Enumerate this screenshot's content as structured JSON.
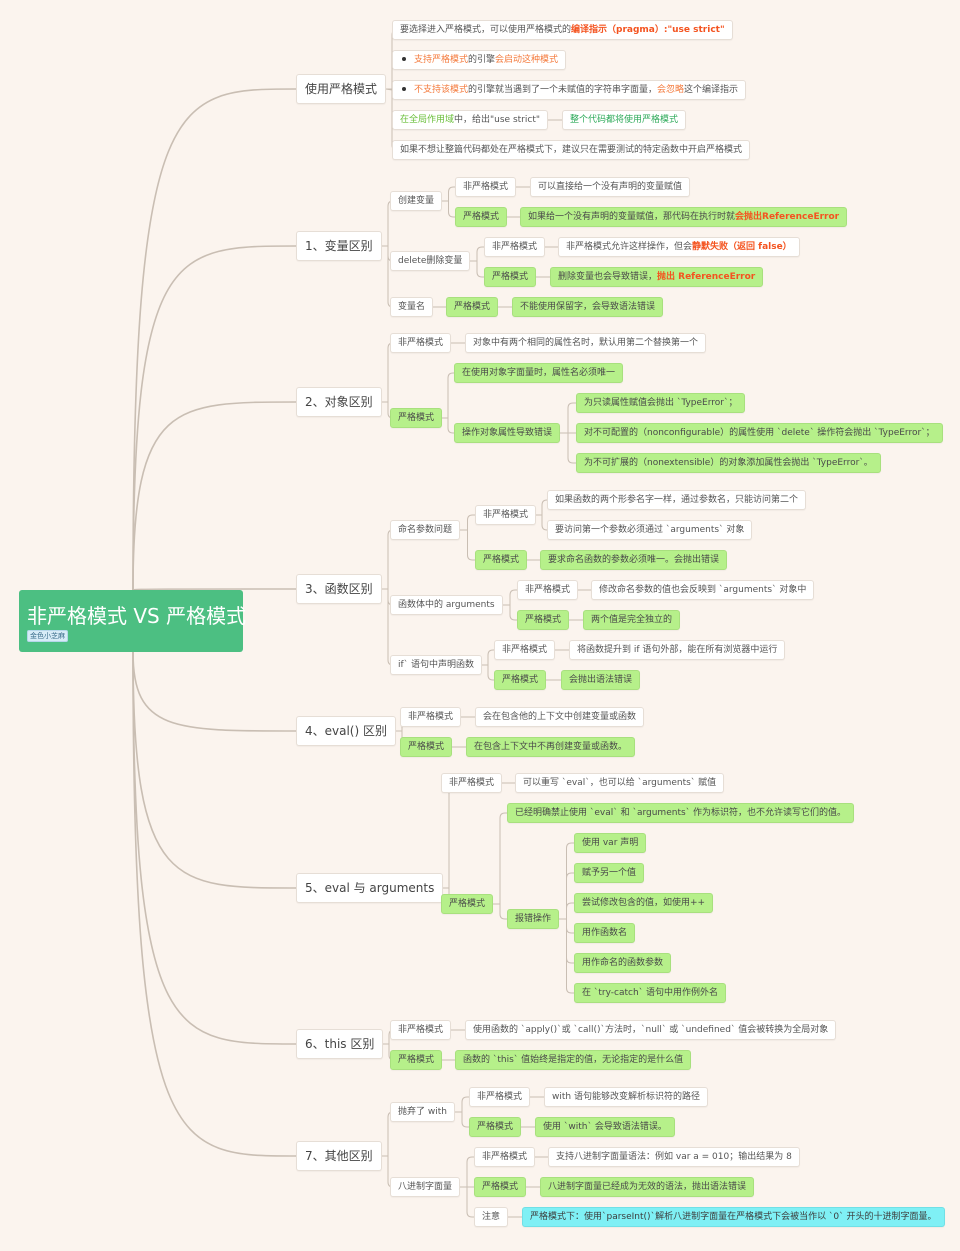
{
  "mindmap": {
    "root": {
      "title": "非严格模式 VS 严格模式",
      "tag": "金色小芝麻",
      "color": "#4cbf82"
    },
    "colors": {
      "background": "#fbf4ee",
      "line": "#c9beb3",
      "green_node": "#b6f08a",
      "cyan_node": "#7ff0f5",
      "highlight_red": "#f4531f",
      "highlight_orange": "#f47a3c"
    },
    "nodes": [
      {
        "id": "b0",
        "parent": "root",
        "level": 1,
        "text": "使用严格模式"
      },
      {
        "id": "b0a",
        "parent": "b0",
        "segments": [
          {
            "t": "要选择进入严格模式，可以使用严格模式的"
          },
          {
            "t": "编译指示（pragma）:\"use strict\"",
            "c": "hl-red"
          }
        ]
      },
      {
        "id": "b0b",
        "parent": "b0",
        "bullet": true,
        "segments": [
          {
            "t": "支持严格模式",
            "c": "hl-orange"
          },
          {
            "t": "的引擎"
          },
          {
            "t": "会启动这种模式",
            "c": "hl-orange"
          }
        ]
      },
      {
        "id": "b0c",
        "parent": "b0",
        "bullet": true,
        "segments": [
          {
            "t": "不支持该模式",
            "c": "hl-orange"
          },
          {
            "t": "的引擎就当遇到了一个未赋值的字符串字面量，"
          },
          {
            "t": "会忽略",
            "c": "hl-orange"
          },
          {
            "t": "这个编译指示"
          }
        ]
      },
      {
        "id": "b0d",
        "parent": "b0",
        "segments": [
          {
            "t": "在全局作用域",
            "c": "hl-lgreen"
          },
          {
            "t": "中，给出\"use strict\""
          }
        ]
      },
      {
        "id": "b0d1",
        "parent": "b0d",
        "segments": [
          {
            "t": "整个代码都将使用严格模式",
            "c": "hl-green"
          }
        ]
      },
      {
        "id": "b0e",
        "parent": "b0",
        "text": "如果不想让整篇代码都处在严格模式下，建议只在需要测试的特定函数中开启严格模式"
      },
      {
        "id": "b1",
        "parent": "root",
        "level": 1,
        "text": "1、变量区别"
      },
      {
        "id": "b1a",
        "parent": "b1",
        "text": "创建变量"
      },
      {
        "id": "b1a1",
        "parent": "b1a",
        "text": "非严格模式"
      },
      {
        "id": "b1a1x",
        "parent": "b1a1",
        "text": "可以直接给一个没有声明的变量赋值"
      },
      {
        "id": "b1a2",
        "parent": "b1a",
        "style": "green",
        "text": "严格模式"
      },
      {
        "id": "b1a2x",
        "parent": "b1a2",
        "style": "green",
        "segments": [
          {
            "t": "如果给一个没有声明的变量赋值，那代码在执行时就"
          },
          {
            "t": "会抛出ReferenceError",
            "c": "hl-red"
          }
        ]
      },
      {
        "id": "b1b",
        "parent": "b1",
        "text": "delete删除变量"
      },
      {
        "id": "b1b1",
        "parent": "b1b",
        "text": "非严格模式"
      },
      {
        "id": "b1b1x",
        "parent": "b1b1",
        "segments": [
          {
            "t": "非严格模式允许这样操作，但会"
          },
          {
            "t": "静默失败（返回 false）",
            "c": "hl-red"
          }
        ]
      },
      {
        "id": "b1b2",
        "parent": "b1b",
        "style": "green",
        "text": "严格模式"
      },
      {
        "id": "b1b2x",
        "parent": "b1b2",
        "style": "green",
        "segments": [
          {
            "t": "删除变量也会导致错误，"
          },
          {
            "t": "抛出 ReferenceError",
            "c": "hl-red"
          }
        ]
      },
      {
        "id": "b1c",
        "parent": "b1",
        "text": "变量名"
      },
      {
        "id": "b1c1",
        "parent": "b1c",
        "style": "green",
        "text": "严格模式"
      },
      {
        "id": "b1c1x",
        "parent": "b1c1",
        "style": "green",
        "text": "不能使用保留字，会导致语法错误"
      },
      {
        "id": "b2",
        "parent": "root",
        "level": 1,
        "text": "2、对象区别"
      },
      {
        "id": "b2a",
        "parent": "b2",
        "text": "非严格模式"
      },
      {
        "id": "b2ax",
        "parent": "b2a",
        "text": "对象中有两个相同的属性名时，默认用第二个替换第一个"
      },
      {
        "id": "b2b",
        "parent": "b2",
        "style": "green",
        "text": "严格模式"
      },
      {
        "id": "b2b1",
        "parent": "b2b",
        "style": "green",
        "text": "在使用对象字面量时，属性名必须唯一"
      },
      {
        "id": "b2b2",
        "parent": "b2b",
        "style": "green",
        "text": "操作对象属性导致错误"
      },
      {
        "id": "b2b2a",
        "parent": "b2b2",
        "style": "green",
        "text": "为只读属性赋值会抛出 `TypeError`；"
      },
      {
        "id": "b2b2b",
        "parent": "b2b2",
        "style": "green",
        "text": "对不可配置的（nonconfigurable）的属性使用 `delete` 操作符会抛出 `TypeError`；"
      },
      {
        "id": "b2b2c",
        "parent": "b2b2",
        "style": "green",
        "text": "为不可扩展的（nonextensible）的对象添加属性会抛出 `TypeError`。"
      },
      {
        "id": "b3",
        "parent": "root",
        "level": 1,
        "text": "3、函数区别"
      },
      {
        "id": "b3a",
        "parent": "b3",
        "text": "命名参数问题"
      },
      {
        "id": "b3a1",
        "parent": "b3a",
        "text": "非严格模式"
      },
      {
        "id": "b3a1a",
        "parent": "b3a1",
        "text": "如果函数的两个形参名字一样，通过参数名，只能访问第二个"
      },
      {
        "id": "b3a1b",
        "parent": "b3a1",
        "text": "要访问第一个参数必须通过 `arguments` 对象"
      },
      {
        "id": "b3a2",
        "parent": "b3a",
        "style": "green",
        "text": "严格模式"
      },
      {
        "id": "b3a2x",
        "parent": "b3a2",
        "style": "green",
        "text": "要求命名函数的参数必须唯一。会抛出错误"
      },
      {
        "id": "b3b",
        "parent": "b3",
        "text": "函数体中的 arguments"
      },
      {
        "id": "b3b1",
        "parent": "b3b",
        "text": "非严格模式"
      },
      {
        "id": "b3b1x",
        "parent": "b3b1",
        "text": "修改命名参数的值也会反映到 `arguments` 对象中"
      },
      {
        "id": "b3b2",
        "parent": "b3b",
        "style": "green",
        "text": "严格模式"
      },
      {
        "id": "b3b2x",
        "parent": "b3b2",
        "style": "green",
        "text": "两个值是完全独立的"
      },
      {
        "id": "b3c",
        "parent": "b3",
        "text": "if` 语句中声明函数"
      },
      {
        "id": "b3c1",
        "parent": "b3c",
        "text": "非严格模式"
      },
      {
        "id": "b3c1x",
        "parent": "b3c1",
        "text": "将函数提升到 if 语句外部，能在所有浏览器中运行"
      },
      {
        "id": "b3c2",
        "parent": "b3c",
        "style": "green",
        "text": "严格模式"
      },
      {
        "id": "b3c2x",
        "parent": "b3c2",
        "style": "green",
        "text": "会抛出语法错误"
      },
      {
        "id": "b4",
        "parent": "root",
        "level": 1,
        "text": "4、eval() 区别"
      },
      {
        "id": "b4a",
        "parent": "b4",
        "text": "非严格模式"
      },
      {
        "id": "b4ax",
        "parent": "b4a",
        "text": "会在包含他的上下文中创建变量或函数"
      },
      {
        "id": "b4b",
        "parent": "b4",
        "style": "green",
        "text": "严格模式"
      },
      {
        "id": "b4bx",
        "parent": "b4b",
        "style": "green",
        "text": "在包含上下文中不再创建变量或函数。"
      },
      {
        "id": "b5",
        "parent": "root",
        "level": 1,
        "text": "5、eval 与 arguments"
      },
      {
        "id": "b5a",
        "parent": "b5",
        "text": "非严格模式"
      },
      {
        "id": "b5ax",
        "parent": "b5a",
        "text": "可以重写 `eval`，也可以给 `arguments` 赋值"
      },
      {
        "id": "b5b",
        "parent": "b5",
        "style": "green",
        "text": "严格模式"
      },
      {
        "id": "b5b1",
        "parent": "b5b",
        "style": "green",
        "text": "已经明确禁止使用 `eval` 和 `arguments` 作为标识符，也不允许读写它们的值。"
      },
      {
        "id": "b5b2",
        "parent": "b5b",
        "style": "green",
        "text": "报错操作"
      },
      {
        "id": "b5b2a",
        "parent": "b5b2",
        "style": "green",
        "text": "使用 var 声明"
      },
      {
        "id": "b5b2b",
        "parent": "b5b2",
        "style": "green",
        "text": "赋予另一个值"
      },
      {
        "id": "b5b2c",
        "parent": "b5b2",
        "style": "green",
        "text": "尝试修改包含的值，如使用++"
      },
      {
        "id": "b5b2d",
        "parent": "b5b2",
        "style": "green",
        "text": "用作函数名"
      },
      {
        "id": "b5b2e",
        "parent": "b5b2",
        "style": "green",
        "text": "用作命名的函数参数"
      },
      {
        "id": "b5b2f",
        "parent": "b5b2",
        "style": "green",
        "text": "在 `try-catch` 语句中用作例外名"
      },
      {
        "id": "b6",
        "parent": "root",
        "level": 1,
        "text": "6、this 区别"
      },
      {
        "id": "b6a",
        "parent": "b6",
        "text": "非严格模式"
      },
      {
        "id": "b6ax",
        "parent": "b6a",
        "text": "使用函数的 `apply()`或 `call()`方法时，`null` 或 `undefined` 值会被转换为全局对象"
      },
      {
        "id": "b6b",
        "parent": "b6",
        "style": "green",
        "text": "严格模式"
      },
      {
        "id": "b6bx",
        "parent": "b6b",
        "style": "green",
        "text": "函数的 `this` 值始终是指定的值，无论指定的是什么值"
      },
      {
        "id": "b7",
        "parent": "root",
        "level": 1,
        "text": "7、其他区别"
      },
      {
        "id": "b7a",
        "parent": "b7",
        "text": "抛弃了 with"
      },
      {
        "id": "b7a1",
        "parent": "b7a",
        "text": "非严格模式"
      },
      {
        "id": "b7a1x",
        "parent": "b7a1",
        "text": "with  语句能够改变解析标识符的路径"
      },
      {
        "id": "b7a2",
        "parent": "b7a",
        "style": "green",
        "text": "严格模式"
      },
      {
        "id": "b7a2x",
        "parent": "b7a2",
        "style": "green",
        "text": "使用 `with` 会导致语法错误。"
      },
      {
        "id": "b7b",
        "parent": "b7",
        "text": "八进制字面量"
      },
      {
        "id": "b7b1",
        "parent": "b7b",
        "text": "非严格模式"
      },
      {
        "id": "b7b1x",
        "parent": "b7b1",
        "text": "支持八进制字面量语法：例如 var a = 010；输出结果为 8"
      },
      {
        "id": "b7b2",
        "parent": "b7b",
        "style": "green",
        "text": "严格模式"
      },
      {
        "id": "b7b2x",
        "parent": "b7b2",
        "style": "green",
        "text": "八进制字面量已经成为无效的语法，抛出语法错误"
      },
      {
        "id": "b7b3",
        "parent": "b7b",
        "text": "注意"
      },
      {
        "id": "b7b3x",
        "parent": "b7b3",
        "style": "cyan",
        "text": "严格模式下：使用`parseInt()`解析八进制字面量在严格模式下会被当作以 `0` 开头的十进制字面量。"
      }
    ]
  }
}
